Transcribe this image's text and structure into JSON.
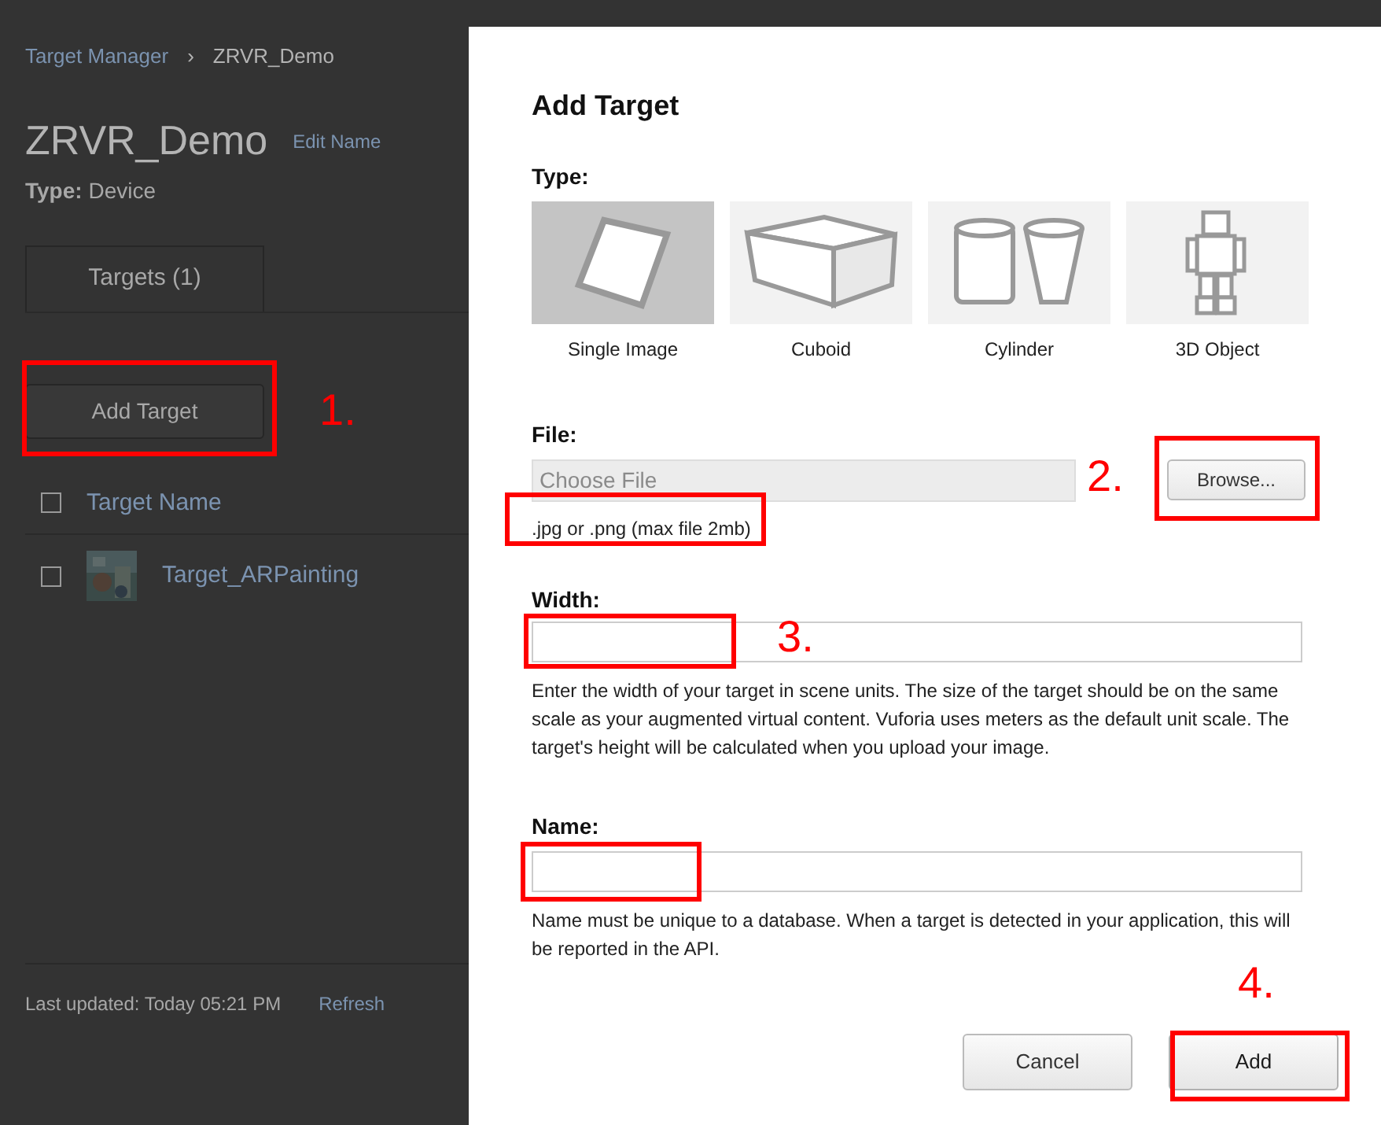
{
  "breadcrumb": [
    {
      "label": "Target Manager",
      "kind": "link"
    },
    {
      "label": "›",
      "kind": "separator"
    },
    {
      "label": "ZRVR_Demo",
      "kind": "current"
    }
  ],
  "database": {
    "title": "ZRVR_Demo",
    "edit_link": "Edit Name",
    "type_label": "Type:",
    "type_value": "Device"
  },
  "tabs": [
    {
      "label": "Targets (1)",
      "selected": true
    }
  ],
  "add_target_button": "Add Target",
  "table": {
    "header_checked": false,
    "columns": [
      "Target Name"
    ],
    "rows": [
      {
        "name": "Target_ARPainting",
        "checked": false,
        "kind": "picture"
      }
    ]
  },
  "footer": {
    "last_updated": "Last updated: Today 05:21 PM",
    "refresh": "Refresh"
  },
  "dialog": {
    "title": "Add Target",
    "type_label": "Type:",
    "types": [
      {
        "label": "Single Image",
        "kind": "single-image",
        "selected": true
      },
      {
        "label": "Cuboid",
        "kind": "cuboid",
        "selected": false
      },
      {
        "label": "Cylinder",
        "kind": "cylinder",
        "selected": false
      },
      {
        "label": "3D Object",
        "kind": "object",
        "selected": false
      }
    ],
    "file_label": "File:",
    "file_placeholder": "Choose File",
    "browse_button": "Browse...",
    "file_hint": ".jpg or .png (max file 2mb)",
    "width_label": "Width:",
    "width_help": "Enter the width of your target in scene units. The size of the target should be on the same scale as your augmented virtual content. Vuforia uses meters as the default unit scale. The target's height will be calculated when you upload your image.",
    "name_label": "Name:",
    "name_help": "Name must be unique to a database. When a target is detected in your application, this will be reported in the API.",
    "buttons": [
      {
        "label": "Cancel",
        "kind": "secondary"
      },
      {
        "label": "Add",
        "kind": "primary"
      }
    ]
  },
  "annotations": [
    {
      "label": "1."
    },
    {
      "label": "2."
    },
    {
      "label": "3."
    },
    {
      "label": "4."
    }
  ]
}
